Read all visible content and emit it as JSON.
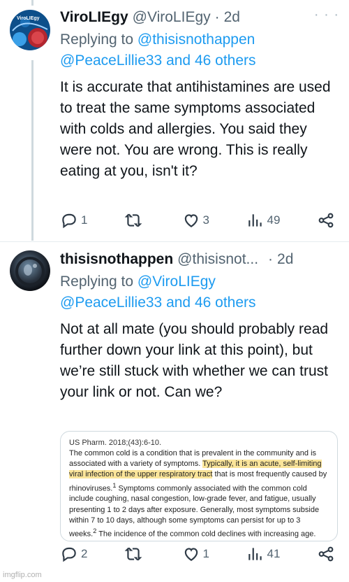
{
  "tweets": [
    {
      "name": "ViroLIEgy",
      "handle": "@ViroLIEgy",
      "time": "2d",
      "avatar_label": "ViroLIEgy",
      "replying_prefix": "Replying to ",
      "replying_user": "@thisisnothappen",
      "replying_more": "@PeaceLillie33 and 46 others",
      "text": "It is accurate that antihistamines are used to treat the same symptoms associated with colds and allergies. You said they were not. You are wrong. This is really eating at you, isn't it?",
      "stats": {
        "replies": "1",
        "retweets": "",
        "likes": "3",
        "views": "49"
      }
    },
    {
      "name": "thisisnothappen",
      "handle": "@thisisnot...",
      "time": "2d",
      "replying_prefix": "Replying to ",
      "replying_user": "@ViroLIEgy",
      "replying_more": "@PeaceLillie33 and 46 others",
      "text": "Not at all mate (you should probably read further down your link at this point), but we’re still stuck with whether we can trust your link or not. Can we?",
      "media": {
        "citation": "US Pharm. 2018;(43):6-10.",
        "part1": "The common cold is a condition that is prevalent in the community and is associated with a variety of symptoms. ",
        "highlight": "Typically, it is an acute, self-limiting viral infection of the upper respiratory tract",
        "part2": " that is most frequently caused by rhinoviruses.",
        "sup1": "1",
        "part3": " Symptoms commonly associated with the common cold include coughing, nasal congestion, low-grade fever, and fatigue, usually presenting 1 to 2 days after exposure. Generally, most symptoms subside within 7 to 10 days, although some symptoms can persist for up to 3 weeks.",
        "sup2": "2",
        "part4": " The incidence of the common cold declines with increasing age."
      },
      "stats": {
        "replies": "2",
        "retweets": "",
        "likes": "1",
        "views": "41"
      }
    }
  ],
  "more_glyph": "· · ·",
  "separator": "·",
  "watermark": "imgflip.com",
  "colors": {
    "link": "#1d9bf0",
    "muted": "#536471",
    "highlight": "#fbe59a"
  },
  "icons": [
    "reply-icon",
    "retweet-icon",
    "like-icon",
    "views-icon",
    "share-icon"
  ]
}
